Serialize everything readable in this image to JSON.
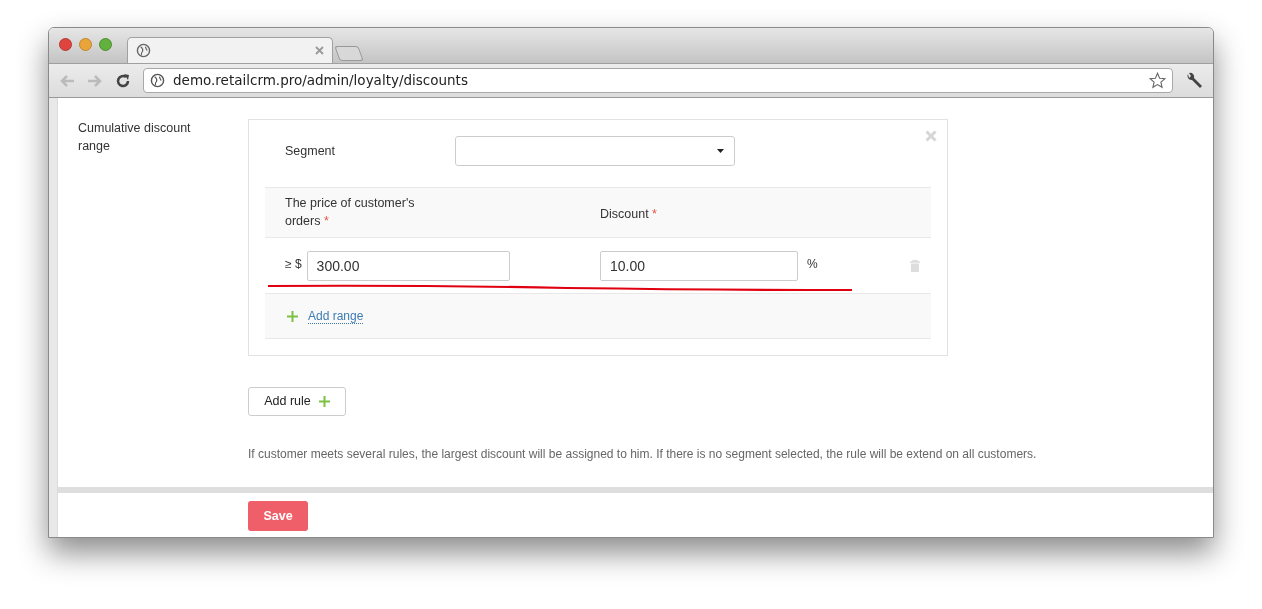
{
  "browser": {
    "address": "demo.retailcrm.pro/admin/loyalty/discounts"
  },
  "field_label": "Cumulative discount range",
  "rule": {
    "segment_label": "Segment",
    "columns": [
      {
        "label": "The price of customer's orders",
        "required_mark": "*"
      },
      {
        "label": "Discount",
        "required_mark": "*"
      }
    ],
    "ranges": [
      {
        "prefix": "≥ $",
        "price": "300.00",
        "discount": "10.00",
        "unit": "%"
      }
    ],
    "add_range": "Add range"
  },
  "add_rule": "Add rule",
  "note": "If customer meets several rules, the largest discount will be assigned to him. If there is no segment selected, the rule will be extend on all customers.",
  "save": "Save"
}
